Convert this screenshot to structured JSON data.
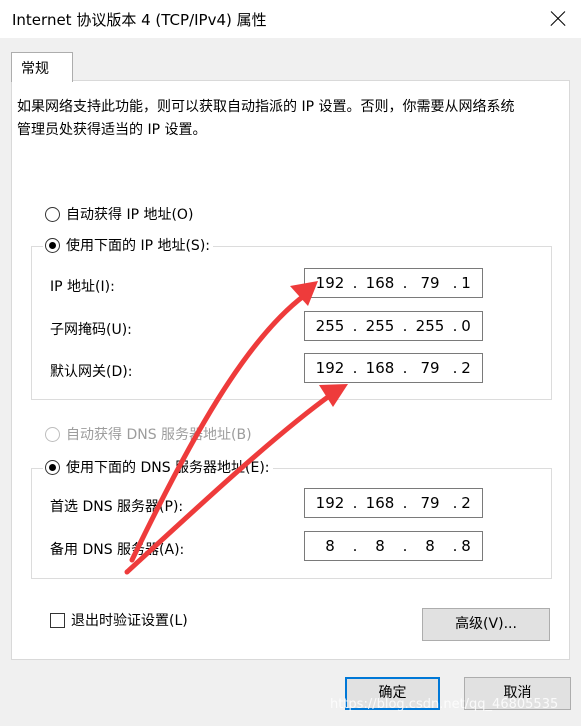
{
  "window": {
    "title": "Internet 协议版本 4 (TCP/IPv4) 属性",
    "close_icon": "close-icon"
  },
  "tabs": [
    {
      "label": "常规"
    }
  ],
  "description": "如果网络支持此功能，则可以获取自动指派的 IP 设置。否则，你需要从网络系统管理员处获得适当的 IP 设置。",
  "ip_section": {
    "auto_label": "自动获得 IP 地址(O)",
    "manual_label": "使用下面的 IP 地址(S):",
    "selected": "manual",
    "fields": [
      {
        "label": "IP 地址(I):",
        "octets": [
          "192",
          "168",
          "79",
          "1"
        ]
      },
      {
        "label": "子网掩码(U):",
        "octets": [
          "255",
          "255",
          "255",
          "0"
        ]
      },
      {
        "label": "默认网关(D):",
        "octets": [
          "192",
          "168",
          "79",
          "2"
        ]
      }
    ]
  },
  "dns_section": {
    "auto_label": "自动获得 DNS 服务器地址(B)",
    "manual_label": "使用下面的 DNS 服务器地址(E):",
    "selected": "manual",
    "fields": [
      {
        "label": "首选 DNS 服务器(P):",
        "octets": [
          "192",
          "168",
          "79",
          "2"
        ]
      },
      {
        "label": "备用 DNS 服务器(A):",
        "octets": [
          "8",
          "8",
          "8",
          "8"
        ]
      }
    ]
  },
  "validate_label": "退出时验证设置(L)",
  "validate_checked": false,
  "buttons": {
    "advanced": "高级(V)...",
    "ok": "确定",
    "cancel": "取消"
  },
  "watermark": "https://blog.csdn.net/qq_46805535",
  "annotation_color": "#ee3b3b"
}
